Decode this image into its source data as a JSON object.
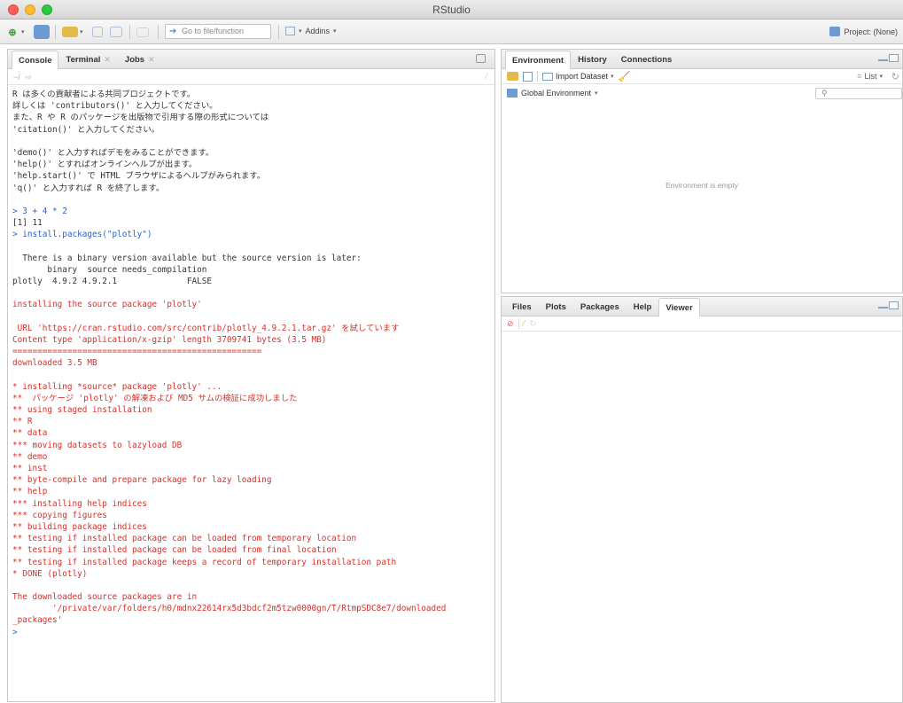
{
  "window": {
    "title": "RStudio"
  },
  "toolbar": {
    "goto_placeholder": "Go to file/function",
    "addins_label": "Addins",
    "project_label": "Project: (None)"
  },
  "console_pane": {
    "tabs": [
      {
        "label": "Console",
        "active": true
      },
      {
        "label": "Terminal",
        "closable": true
      },
      {
        "label": "Jobs",
        "closable": true
      }
    ],
    "path": "~/",
    "lines": [
      {
        "text": "R は多くの貢献者による共同プロジェクトです。",
        "style": "norm"
      },
      {
        "text": "詳しくは 'contributors()' と入力してください。",
        "style": "norm"
      },
      {
        "text": "また、R や R のパッケージを出版物で引用する際の形式については",
        "style": "norm"
      },
      {
        "text": "'citation()' と入力してください。",
        "style": "norm"
      },
      {
        "text": "",
        "style": "blank"
      },
      {
        "text": "'demo()' と入力すればデモをみることができます。",
        "style": "norm"
      },
      {
        "text": "'help()' とすればオンラインヘルプが出ます。",
        "style": "norm"
      },
      {
        "text": "'help.start()' で HTML ブラウザによるヘルプがみられます。",
        "style": "norm"
      },
      {
        "text": "'q()' と入力すれば R を終了します。",
        "style": "norm"
      },
      {
        "text": "",
        "style": "blank"
      },
      {
        "text": "> 3 + 4 * 2",
        "style": "in"
      },
      {
        "text": "[1] 11",
        "style": "norm"
      },
      {
        "text": "> install.packages(\"plotly\")",
        "style": "in"
      },
      {
        "text": "",
        "style": "blank"
      },
      {
        "text": "  There is a binary version available but the source version is later:",
        "style": "norm"
      },
      {
        "text": "       binary  source needs_compilation",
        "style": "norm"
      },
      {
        "text": "plotly  4.9.2 4.9.2.1              FALSE",
        "style": "norm"
      },
      {
        "text": "",
        "style": "blank"
      },
      {
        "text": "installing the source package 'plotly'",
        "style": "err"
      },
      {
        "text": "",
        "style": "blank"
      },
      {
        "text": " URL 'https://cran.rstudio.com/src/contrib/plotly_4.9.2.1.tar.gz' を試しています",
        "style": "err"
      },
      {
        "text": "Content type 'application/x-gzip' length 3709741 bytes (3.5 MB)",
        "style": "err"
      },
      {
        "text": "==================================================",
        "style": "err"
      },
      {
        "text": "downloaded 3.5 MB",
        "style": "err"
      },
      {
        "text": "",
        "style": "blank"
      },
      {
        "text": "* installing *source* package 'plotly' ...",
        "style": "err"
      },
      {
        "text": "**  パッケージ 'plotly' の解凍および MD5 サムの検証に成功しました",
        "style": "err"
      },
      {
        "text": "** using staged installation",
        "style": "err"
      },
      {
        "text": "** R",
        "style": "err"
      },
      {
        "text": "** data",
        "style": "err"
      },
      {
        "text": "*** moving datasets to lazyload DB",
        "style": "err"
      },
      {
        "text": "** demo",
        "style": "err"
      },
      {
        "text": "** inst",
        "style": "err"
      },
      {
        "text": "** byte-compile and prepare package for lazy loading",
        "style": "err"
      },
      {
        "text": "** help",
        "style": "err"
      },
      {
        "text": "*** installing help indices",
        "style": "err"
      },
      {
        "text": "*** copying figures",
        "style": "err"
      },
      {
        "text": "** building package indices",
        "style": "err"
      },
      {
        "text": "** testing if installed package can be loaded from temporary location",
        "style": "err"
      },
      {
        "text": "** testing if installed package can be loaded from final location",
        "style": "err"
      },
      {
        "text": "** testing if installed package keeps a record of temporary installation path",
        "style": "err"
      },
      {
        "text": "* DONE (plotly)",
        "style": "err"
      },
      {
        "text": "",
        "style": "blank"
      },
      {
        "text": "The downloaded source packages are in",
        "style": "err"
      },
      {
        "text": "        '/private/var/folders/h0/mdnx22614rx5d3bdcf2m5tzw0000gn/T/RtmpSDC8e7/downloaded",
        "style": "err"
      },
      {
        "text": "_packages'",
        "style": "err"
      },
      {
        "text": ">",
        "style": "in"
      }
    ]
  },
  "env_pane": {
    "tabs": [
      {
        "label": "Environment",
        "active": true
      },
      {
        "label": "History"
      },
      {
        "label": "Connections"
      }
    ],
    "import_label": "Import Dataset",
    "list_label": "List",
    "scope_label": "Global Environment",
    "empty_text": "Environment is empty"
  },
  "files_pane": {
    "tabs": [
      {
        "label": "Files"
      },
      {
        "label": "Plots"
      },
      {
        "label": "Packages"
      },
      {
        "label": "Help"
      },
      {
        "label": "Viewer",
        "active": true
      }
    ]
  },
  "colors": {
    "input": "#2c61c9",
    "message": "#d6302a",
    "text": "#333333"
  }
}
